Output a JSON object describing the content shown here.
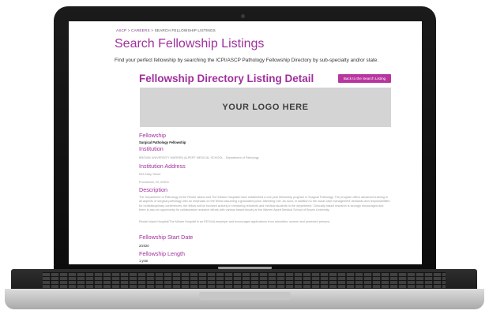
{
  "breadcrumb": {
    "items": [
      "ASCP",
      "CAREERS",
      "SEARCH FELLOWSHIP LISTINGS"
    ],
    "separator": ">"
  },
  "page": {
    "title": "Search Fellowship Listings",
    "intro": "Find your perfect fellowship by searching the ICPI/ASCP Pathology Fellowship Directory by sub-specialty and/or state."
  },
  "detail": {
    "title": "Fellowship Directory Listing Detail",
    "back_button": "Back to the Search Listing",
    "logo_placeholder": "YOUR LOGO HERE"
  },
  "sections": {
    "fellowship": {
      "label": "Fellowship",
      "value": "Surgical Pathology Fellowship"
    },
    "institution": {
      "label": "Institution",
      "value": "BROWN UNIVERSITY WARREN ALPERT MEDICAL SCHOOL - Department of Pathology"
    },
    "address": {
      "label": "Institution Address",
      "line1": "593 Eddy Street",
      "line2": "Providence, RI, 02903"
    },
    "description": {
      "label": "Description",
      "para1": "The Department of Pathology at the Rhode Island and The Miriam Hospitals have established a one year fellowship program in Surgical Pathology. The program offers advanced training in all aspects of surgical pathology with an emphasis on the fellow assuming a graduated junior attending role. As such, in addition to the usual case management demands and responsibilities for multidisciplinary conferences, the fellow will be involved actively in mentoring residents and medical students in the department. Clinically based research is strongly encouraged and there is also an opportunity for collaborative research efforts with various based faculty at the Warren Alpert Medical School of Brown University.",
      "para2": "Rhode Island Hospital/The Miriam Hospital is an EEO/AA employer and encourages applications from minorities, women and protected persons."
    },
    "start_date": {
      "label": "Fellowship Start Date",
      "value": "2/2020"
    },
    "length": {
      "label": "Fellowship Length",
      "value": "1 year"
    }
  }
}
